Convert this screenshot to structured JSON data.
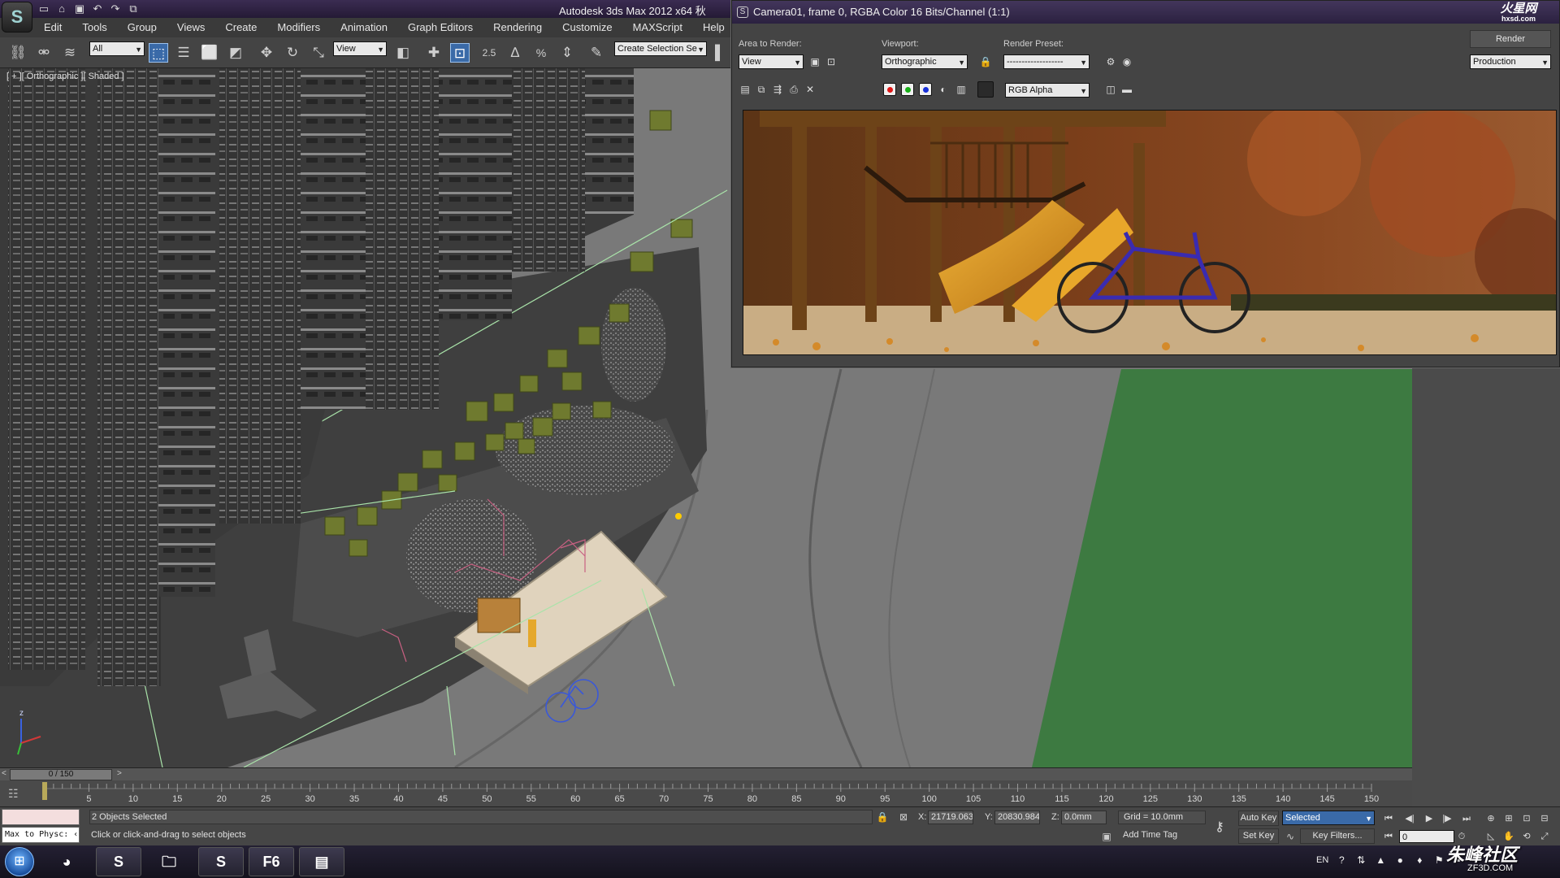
{
  "app": {
    "title": "Autodesk 3ds Max  2012 x64",
    "title_suffix": "秋"
  },
  "quick_access": {
    "icons": [
      "new-file-icon",
      "open-file-icon",
      "save-icon",
      "undo-icon",
      "redo-icon",
      "hold-icon"
    ]
  },
  "menu": {
    "items": [
      "Edit",
      "Tools",
      "Group",
      "Views",
      "Create",
      "Modifiers",
      "Animation",
      "Graph Editors",
      "Rendering",
      "Customize",
      "MAXScript",
      "Help"
    ]
  },
  "toolbar": {
    "selection_filter": "All",
    "ref_coord_system": "View",
    "snap_value": "2.5",
    "angle_snap_symbol": "∆",
    "percent_snap_symbol": "%",
    "named_selection_placeholder": "Create Selection Se"
  },
  "viewport": {
    "label": "[ + ][ Orthographic ][ Shaded ]"
  },
  "render_window": {
    "title": "Camera01, frame 0, RGBA Color 16 Bits/Channel (1:1)",
    "watermark_top": "火星网",
    "watermark_top_sub": "hxsd.com",
    "area_to_render_label": "Area to Render:",
    "area_to_render_value": "View",
    "viewport_label": "Viewport:",
    "viewport_value": "Orthographic",
    "render_preset_label": "Render Preset:",
    "render_preset_value": "-------------------",
    "render_button": "Render",
    "render_mode_value": "Production",
    "channel_value": "RGB Alpha",
    "channel_colors": {
      "red": "#e01818",
      "green": "#18b018",
      "blue": "#1830d8"
    }
  },
  "timeline": {
    "slider_value": "0 / 150",
    "prev_symbol": "<",
    "next_symbol": ">",
    "ticks": [
      0,
      5,
      10,
      15,
      20,
      25,
      30,
      35,
      40,
      45,
      50,
      55,
      60,
      65,
      70,
      75,
      80,
      85,
      90,
      95,
      100,
      105,
      110,
      115,
      120,
      125,
      130,
      135,
      140,
      145,
      150
    ],
    "frame_min": 0,
    "frame_max": 150
  },
  "status": {
    "maxscript_listener": "Max to Physc: ‹",
    "selection_text": "2 Objects Selected",
    "prompt_text": "Click or click-and-drag to select objects",
    "x_label": "X:",
    "x_value": "21719.063",
    "y_label": "Y:",
    "y_value": "20830.984",
    "z_label": "Z:",
    "z_value": "0.0mm",
    "grid_text": "Grid = 10.0mm",
    "add_time_tag": "Add Time Tag",
    "auto_key": "Auto Key",
    "set_key": "Set Key",
    "selected_value": "Selected",
    "key_filters": "Key Filters...",
    "current_frame": "0"
  },
  "taskbar": {
    "f6_label": "F6",
    "language": "EN",
    "watermark": "朱峰社区",
    "watermark_sub": "ZF3D.COM"
  },
  "colors": {
    "grass": "#3d7a41",
    "ground": "#7a7a7a",
    "building": "#3e3e3e",
    "selection_blue": "#3a6aa8"
  }
}
